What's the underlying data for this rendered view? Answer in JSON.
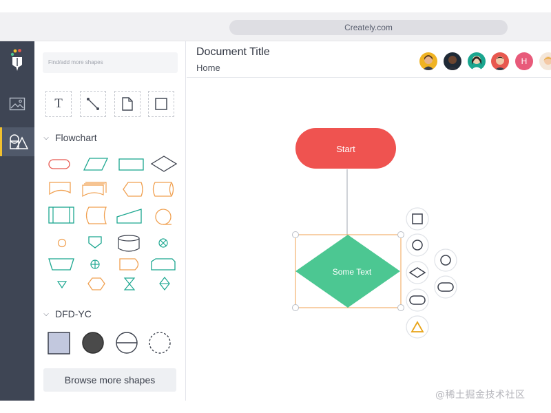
{
  "browser": {
    "url": "Creately.com"
  },
  "rail": {
    "items": [
      {
        "name": "logo",
        "icon": "creately-logo-icon"
      },
      {
        "name": "images",
        "icon": "image-icon"
      },
      {
        "name": "shapes",
        "icon": "shapes-icon",
        "active": true
      }
    ],
    "accent": "#f2c12e"
  },
  "panel": {
    "search_placeholder": "Find/add more shapes",
    "tools": [
      {
        "name": "text-tool",
        "glyph": "T"
      },
      {
        "name": "line-tool",
        "glyph": "line"
      },
      {
        "name": "note-tool",
        "glyph": "page"
      },
      {
        "name": "rectangle-tool",
        "glyph": "square"
      }
    ],
    "sections": [
      {
        "title": "Flowchart",
        "expanded": true
      },
      {
        "title": "DFD-YC",
        "expanded": true
      }
    ],
    "browse_label": "Browse more shapes"
  },
  "header": {
    "title": "Document Title",
    "breadcrumb": "Home",
    "collaborators": [
      {
        "kind": "photo",
        "color": "#f0b323"
      },
      {
        "kind": "photo",
        "color": "#1f2a36"
      },
      {
        "kind": "photo",
        "color": "#1aa68f"
      },
      {
        "kind": "photo",
        "color": "#e8584f"
      },
      {
        "kind": "initial",
        "initial": "H",
        "color": "#e85a7a"
      },
      {
        "kind": "photo",
        "color": "#f4c9a6"
      }
    ]
  },
  "canvas": {
    "start_label": "Start",
    "diamond_label": "Some Text",
    "start_color": "#ef5350",
    "diamond_color": "#4cc792",
    "selection_color": "#f0a050",
    "quick_shape_warning_color": "#e8a317"
  },
  "watermark": "@稀土掘金技术社区"
}
